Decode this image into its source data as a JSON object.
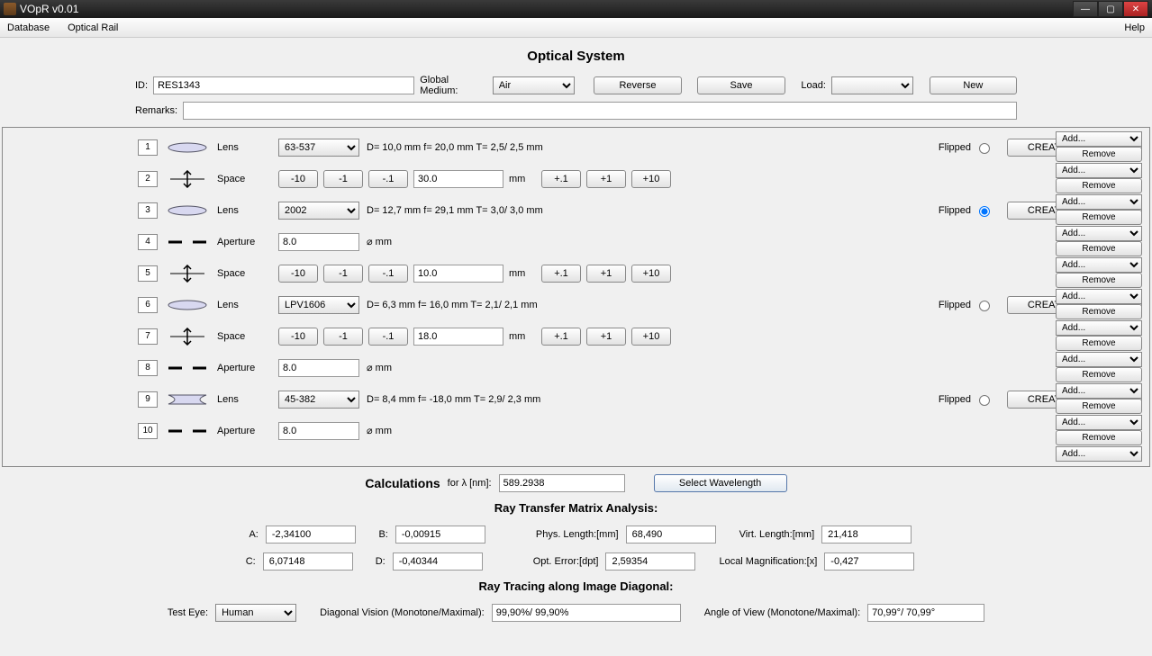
{
  "window": {
    "title": "VOpR v0.01"
  },
  "menu": {
    "database": "Database",
    "optical_rail": "Optical Rail",
    "help": "Help"
  },
  "header": {
    "title": "Optical System",
    "id_label": "ID:",
    "id_value": "RES1343",
    "global_medium_label": "Global Medium:",
    "global_medium_value": "Air",
    "reverse": "Reverse",
    "save": "Save",
    "load_label": "Load:",
    "new": "New",
    "remarks_label": "Remarks:",
    "remarks_value": ""
  },
  "side": {
    "add": "Add...",
    "remove": "Remove"
  },
  "rows": [
    {
      "idx": "1",
      "type": "Lens",
      "lens": "63-537",
      "spec": "D=  10,0 mm  f=  20,0 mm  T=  2,5/  2,5 mm",
      "flipped_label": "Flipped",
      "flipped": false,
      "create": "CREATE NEW LENS"
    },
    {
      "idx": "2",
      "type": "Space",
      "value": "30.0",
      "unit": "mm"
    },
    {
      "idx": "3",
      "type": "Lens",
      "lens": "2002",
      "spec": "D=  12,7 mm  f=  29,1 mm  T=  3,0/  3,0 mm",
      "flipped_label": "Flipped",
      "flipped": true,
      "create": "CREATE NEW LENS"
    },
    {
      "idx": "4",
      "type": "Aperture",
      "value": "8.0",
      "unit": "⌀ mm"
    },
    {
      "idx": "5",
      "type": "Space",
      "value": "10.0",
      "unit": "mm"
    },
    {
      "idx": "6",
      "type": "Lens",
      "lens": "LPV1606",
      "spec": "D=   6,3 mm  f=  16,0 mm  T=  2,1/  2,1 mm",
      "flipped_label": "Flipped",
      "flipped": false,
      "create": "CREATE NEW LENS"
    },
    {
      "idx": "7",
      "type": "Space",
      "value": "18.0",
      "unit": "mm"
    },
    {
      "idx": "8",
      "type": "Aperture",
      "value": "8.0",
      "unit": "⌀ mm"
    },
    {
      "idx": "9",
      "type": "Lens",
      "lens": "45-382",
      "spec": "D=   8,4 mm  f= -18,0 mm  T=  2,9/  2,3 mm",
      "flipped_label": "Flipped",
      "flipped": false,
      "create": "CREATE NEW LENS"
    },
    {
      "idx": "10",
      "type": "Aperture",
      "value": "8.0",
      "unit": "⌀ mm"
    }
  ],
  "steps": {
    "m10": "-10",
    "m1": "-1",
    "md1": "-.1",
    "pd1": "+.1",
    "p1": "+1",
    "p10": "+10"
  },
  "calc": {
    "title": "Calculations",
    "for_lambda": "for λ [nm]:",
    "lambda_value": "589.2938",
    "select_wl": "Select Wavelength",
    "rtm_title": "Ray Transfer Matrix Analysis:",
    "A_label": "A:",
    "A": "-2,34100",
    "B_label": "B:",
    "B": "-0,00915",
    "C_label": "C:",
    "C": "6,07148",
    "D_label": "D:",
    "D": "-0,40344",
    "phys_len_label": "Phys. Length:[mm]",
    "phys_len": "68,490",
    "virt_len_label": "Virt. Length:[mm]",
    "virt_len": "21,418",
    "opt_err_label": "Opt. Error:[dpt]",
    "opt_err": "2,59354",
    "local_mag_label": "Local Magnification:[x]",
    "local_mag": "-0,427",
    "rt_title": "Ray Tracing along Image Diagonal:",
    "test_eye_label": "Test Eye:",
    "test_eye_value": "Human",
    "diag_vision_label": "Diagonal Vision (Monotone/Maximal):",
    "diag_vision": "99,90%/ 99,90%",
    "aov_label": "Angle of View (Monotone/Maximal):",
    "aov": "70,99°/ 70,99°"
  }
}
